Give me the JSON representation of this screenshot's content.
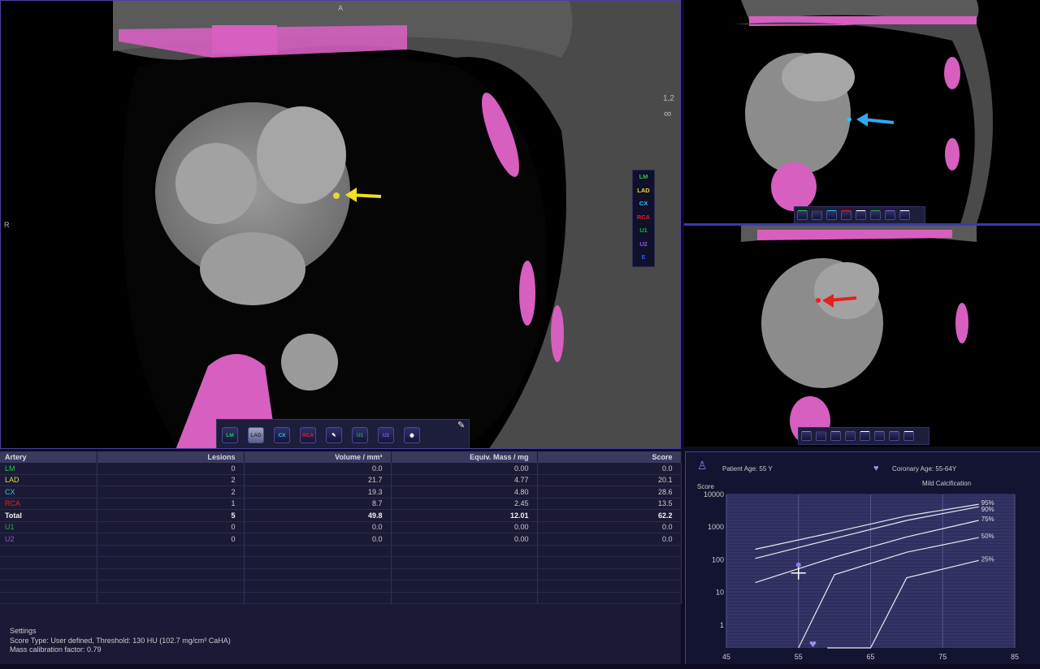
{
  "main_view": {
    "orientation_top": "A",
    "orientation_left": "R",
    "series_label": "1,2"
  },
  "artery_legend": [
    {
      "label": "LM",
      "color": "#22cc44"
    },
    {
      "label": "LAD",
      "color": "#e6d830"
    },
    {
      "label": "CX",
      "color": "#22c8e6"
    },
    {
      "label": "RCA",
      "color": "#e62020"
    },
    {
      "label": "U1",
      "color": "#22aa44"
    },
    {
      "label": "U2",
      "color": "#8855dd"
    },
    {
      "label": "E",
      "color": "#3355ee"
    }
  ],
  "main_toolbar": [
    {
      "label": "LM",
      "color": "#22cc44"
    },
    {
      "label": "LAD",
      "color": "#333333"
    },
    {
      "label": "CX",
      "color": "#22c8e6"
    },
    {
      "label": "RCA",
      "color": "#e62020"
    },
    {
      "label": "",
      "color": "#ffffff"
    },
    {
      "label": "U1",
      "color": "#22aa44"
    },
    {
      "label": "U2",
      "color": "#8855dd"
    },
    {
      "label": "",
      "color": "#ffffff"
    }
  ],
  "table": {
    "headers": [
      "Artery",
      "Lesions",
      "Volume / mm³",
      "Equiv. Mass / mg",
      "Score"
    ],
    "rows": [
      {
        "artery": "LM",
        "color": "#22cc44",
        "lesions": "0",
        "volume": "0.0",
        "mass": "0.00",
        "score": "0.0"
      },
      {
        "artery": "LAD",
        "color": "#e6d830",
        "lesions": "2",
        "volume": "21.7",
        "mass": "4.77",
        "score": "20.1"
      },
      {
        "artery": "CX",
        "color": "#22c8e6",
        "lesions": "2",
        "volume": "19.3",
        "mass": "4.80",
        "score": "28.6"
      },
      {
        "artery": "RCA",
        "color": "#e62020",
        "lesions": "1",
        "volume": "8.7",
        "mass": "2.45",
        "score": "13.5"
      },
      {
        "artery": "Total",
        "color": "#f0f0f0",
        "lesions": "5",
        "volume": "49.8",
        "mass": "12.01",
        "score": "62.2",
        "total": true
      },
      {
        "artery": "U1",
        "color": "#22aa44",
        "lesions": "0",
        "volume": "0.0",
        "mass": "0.00",
        "score": "0.0"
      },
      {
        "artery": "U2",
        "color": "#8855dd",
        "lesions": "0",
        "volume": "0.0",
        "mass": "0.00",
        "score": "0.0"
      }
    ],
    "empty_rows": 5
  },
  "settings": {
    "title": "Settings",
    "score_type": "Score Type: User defined, Threshold: 130 HU (102.7 mg/cm³ CaHA)",
    "calibration": "Mass calibration factor: 0.79"
  },
  "chart_info": {
    "patient_age": "Patient Age: 55 Y",
    "coronary_age": "Coronary Age: 55-64Y",
    "status": "Mild Calcification",
    "y_caption": "Score"
  },
  "chart_data": {
    "type": "line",
    "x_ticks": [
      45,
      55,
      65,
      75,
      85
    ],
    "y_ticks": [
      "10000",
      "1000",
      "100",
      "10",
      "1"
    ],
    "y_scale": "log",
    "xlim": [
      45,
      85
    ],
    "ylim": [
      0.2,
      10000
    ],
    "series": [
      {
        "name": "95%",
        "points": [
          [
            49,
            210
          ],
          [
            60,
            700
          ],
          [
            70,
            2200
          ],
          [
            80,
            5000
          ]
        ]
      },
      {
        "name": "90%",
        "points": [
          [
            49,
            110
          ],
          [
            60,
            450
          ],
          [
            70,
            1600
          ],
          [
            80,
            4200
          ]
        ]
      },
      {
        "name": "75%",
        "points": [
          [
            49,
            20
          ],
          [
            60,
            120
          ],
          [
            70,
            500
          ],
          [
            80,
            1600
          ]
        ]
      },
      {
        "name": "50%",
        "points": [
          [
            55,
            0.2
          ],
          [
            60,
            35
          ],
          [
            70,
            170
          ],
          [
            80,
            480
          ]
        ]
      },
      {
        "name": "25%",
        "points": [
          [
            59,
            0.2
          ],
          [
            65,
            0.2
          ],
          [
            70,
            28
          ],
          [
            80,
            95
          ]
        ]
      }
    ],
    "patient_marker": {
      "x": 55,
      "y": 62.2
    },
    "coronary_age_marker": {
      "x": 57,
      "y": 0.2
    }
  }
}
